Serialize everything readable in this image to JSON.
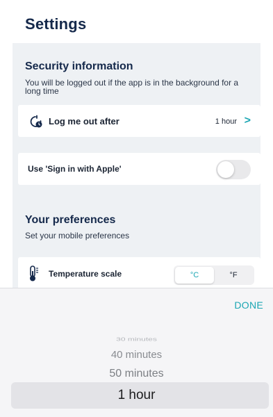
{
  "header": {
    "title": "Settings"
  },
  "security": {
    "title": "Security information",
    "subtitle": "You will be logged out if the app is in the background for a long time",
    "logout": {
      "label": "Log me out after",
      "value": "1 hour",
      "icon": "timer-clock-icon"
    },
    "apple": {
      "label": "Use 'Sign in with Apple'",
      "enabled": false
    }
  },
  "preferences": {
    "title": "Your preferences",
    "subtitle": "Set your mobile preferences",
    "temperature": {
      "label": "Temperature scale",
      "icon": "thermometer-icon",
      "options": [
        "°C",
        "°F"
      ],
      "selected": "°C"
    }
  },
  "picker": {
    "done_label": "DONE",
    "items": [
      "30 minutes",
      "40 minutes",
      "50 minutes",
      "1 hour"
    ],
    "selected": "1 hour"
  },
  "colors": {
    "accent": "#1ba6b3",
    "title": "#15294b",
    "panel": "#eef1f4"
  }
}
